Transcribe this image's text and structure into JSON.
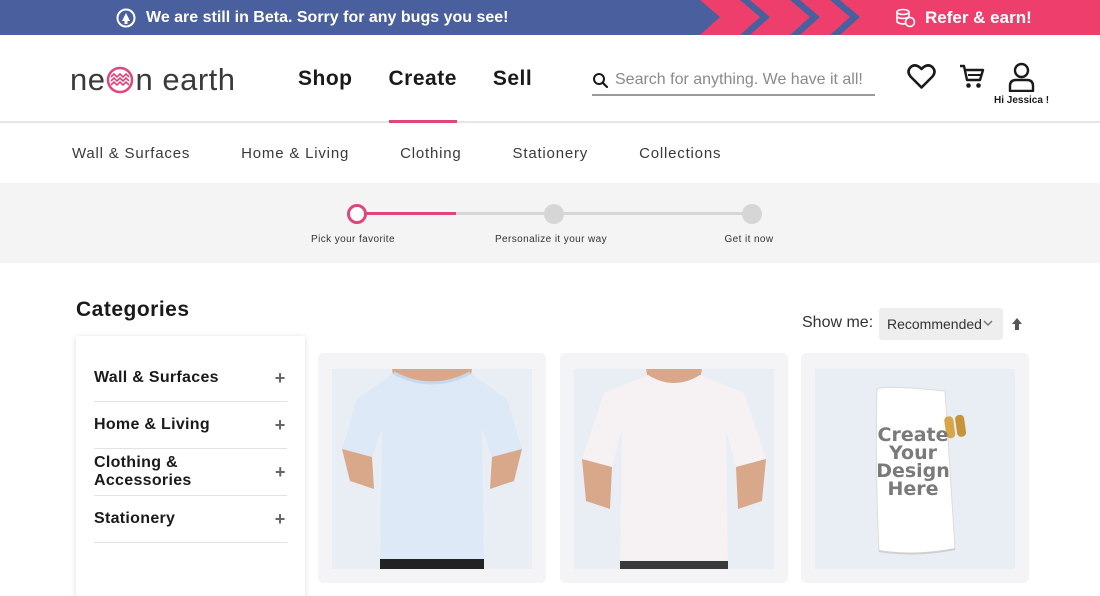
{
  "banner": {
    "beta_text": "We are still in Beta. Sorry for any bugs you see!",
    "refer_text": "Refer & earn!",
    "left_bg": "#4a5f9d",
    "right_bg": "#ee3f6c"
  },
  "header": {
    "logo_text_1": "ne",
    "logo_text_2": "n earth",
    "nav": [
      {
        "label": "Shop"
      },
      {
        "label": "Create"
      },
      {
        "label": "Sell"
      }
    ],
    "active_nav": "Create",
    "search_placeholder": "Search for anything. We have it all!",
    "greeting": "Hi Jessica !",
    "accent": "#e0457b"
  },
  "subnav": [
    {
      "label": "Wall & Surfaces"
    },
    {
      "label": "Home & Living"
    },
    {
      "label": "Clothing"
    },
    {
      "label": "Stationery"
    },
    {
      "label": "Collections"
    }
  ],
  "stepper": {
    "steps": [
      {
        "label": "Pick your favorite"
      },
      {
        "label": "Personalize it your way"
      },
      {
        "label": "Get it now"
      }
    ],
    "current_step": 1
  },
  "categories": {
    "title": "Categories",
    "items": [
      {
        "label": "Wall & Surfaces",
        "icon": "plus-icon"
      },
      {
        "label": "Home & Living",
        "icon": "plus-icon"
      },
      {
        "label": "Clothing & Accessories",
        "icon": "plus-icon"
      },
      {
        "label": "Stationery",
        "icon": "plus-icon"
      }
    ]
  },
  "sort": {
    "label": "Show me:",
    "selected": "Recommended"
  },
  "products": [
    {
      "kind": "womens-tshirt",
      "color": "#e4eef8"
    },
    {
      "kind": "mens-tshirt",
      "color": "#f4f0f2"
    },
    {
      "kind": "beach-towel",
      "overlay_text": "Create\nYour\nDesign\nHere"
    }
  ]
}
